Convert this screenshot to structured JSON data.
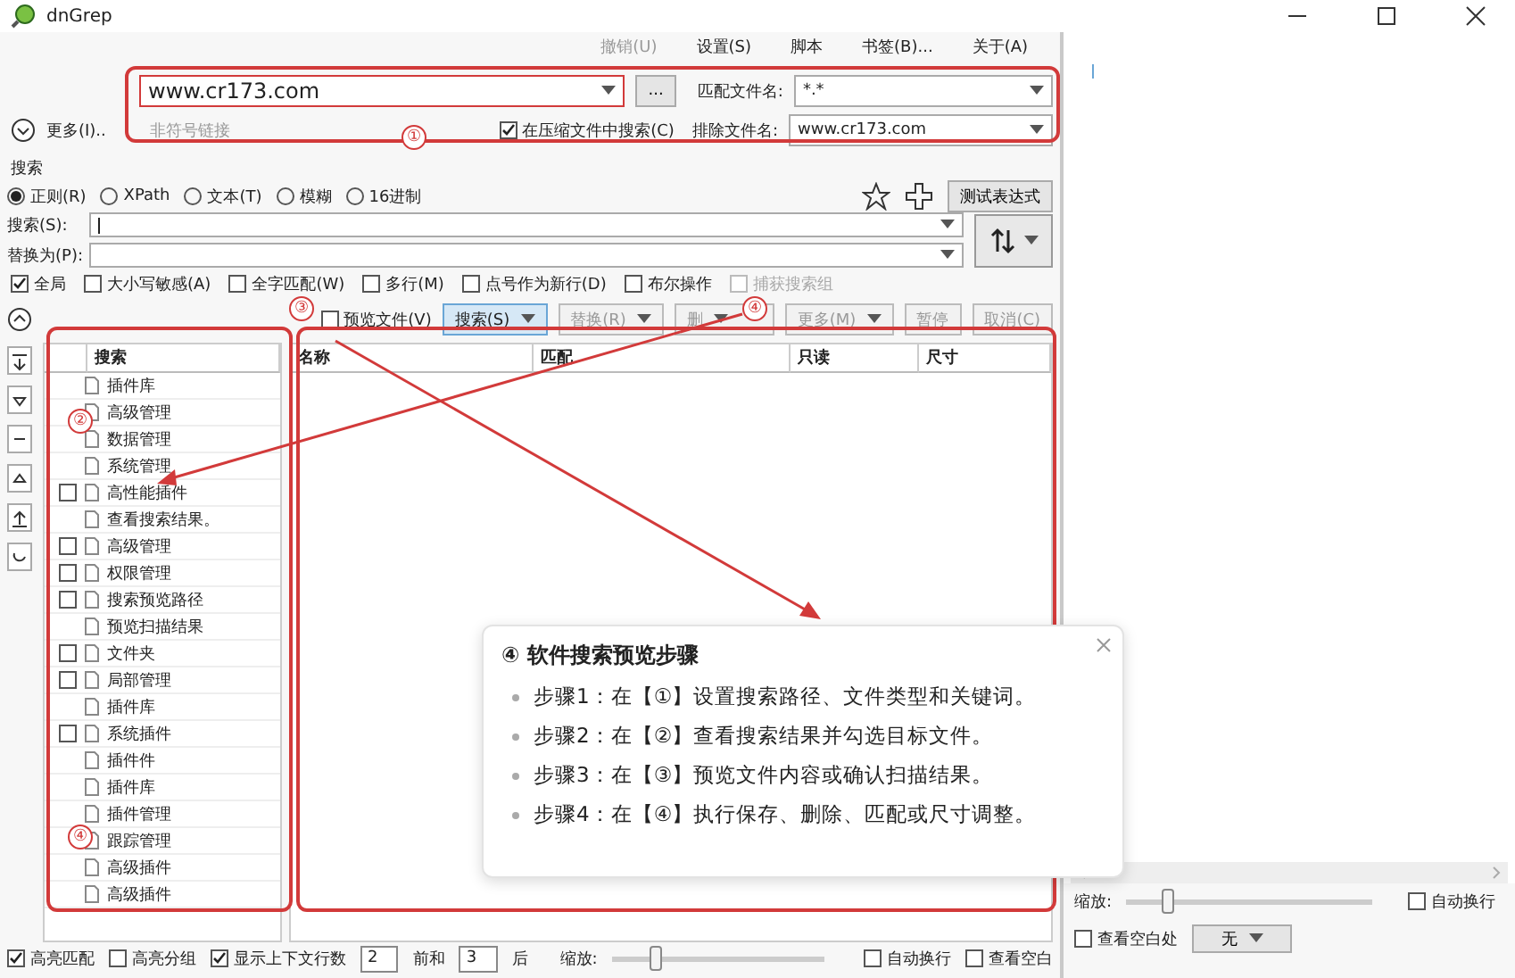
{
  "window": {
    "title": "dnGrep"
  },
  "menu": [
    {
      "label": "撤销(U)",
      "disabled": true
    },
    {
      "label": "设置(S)",
      "disabled": false
    },
    {
      "label": "脚本",
      "disabled": false
    },
    {
      "label": "书签(B)...",
      "disabled": false
    },
    {
      "label": "关于(A)",
      "disabled": false
    }
  ],
  "path": {
    "value": "www.cr173.com",
    "browse": "...",
    "expand_label": "更多(I)..",
    "hint": "非符号链接",
    "archive": {
      "label": "在压缩文件中搜索(C)",
      "checked": true
    },
    "include": {
      "label": "匹配文件名:",
      "value": "*.*"
    },
    "exclude": {
      "label": "排除文件名:",
      "value": "www.cr173.com"
    }
  },
  "search": {
    "title": "搜索",
    "modes": [
      {
        "label": "正则(R)",
        "selected": true
      },
      {
        "label": "XPath",
        "selected": false
      },
      {
        "label": "文本(T)",
        "selected": false
      },
      {
        "label": "模糊",
        "selected": false
      },
      {
        "label": "16进制",
        "selected": false
      }
    ],
    "test_button": "测试表达式",
    "search_label": "搜索(S):",
    "replace_label": "替换为(P):",
    "options": [
      {
        "label": "全局",
        "checked": true,
        "disabled": false
      },
      {
        "label": "大小写敏感(A)",
        "checked": false,
        "disabled": false
      },
      {
        "label": "全字匹配(W)",
        "checked": false,
        "disabled": false
      },
      {
        "label": "多行(M)",
        "checked": false,
        "disabled": false
      },
      {
        "label": "点号作为新行(D)",
        "checked": false,
        "disabled": false
      },
      {
        "label": "布尔操作",
        "checked": false,
        "disabled": false
      },
      {
        "label": "捕获搜索组",
        "checked": false,
        "disabled": true
      }
    ]
  },
  "actions": {
    "preview": {
      "label": "预览文件(V)",
      "checked": false
    },
    "buttons": [
      {
        "label": "搜索(S)",
        "primary": true,
        "disabled": false,
        "dropdown": true
      },
      {
        "label": "替换(R)",
        "primary": false,
        "disabled": true,
        "dropdown": true
      },
      {
        "label": "删",
        "primary": false,
        "disabled": true,
        "dropdown": true
      },
      {
        "label": "更多(M)",
        "primary": false,
        "disabled": true,
        "dropdown": true
      },
      {
        "label": "暂停",
        "primary": false,
        "disabled": true,
        "dropdown": false
      },
      {
        "label": "取消(C)",
        "primary": false,
        "disabled": true,
        "dropdown": false
      }
    ]
  },
  "tree": {
    "header": "搜索",
    "items": [
      {
        "label": "插件库",
        "kind": "plain"
      },
      {
        "label": "高级管理",
        "kind": "plain"
      },
      {
        "label": "数据管理",
        "kind": "plain"
      },
      {
        "label": "系统管理",
        "kind": "plain"
      },
      {
        "label": "高性能插件",
        "kind": "check",
        "checked": false
      },
      {
        "label": "查看搜索结果。",
        "kind": "plain"
      },
      {
        "label": "高级管理",
        "kind": "check",
        "checked": false
      },
      {
        "label": "权限管理",
        "kind": "check",
        "checked": false
      },
      {
        "label": "搜索预览路径",
        "kind": "check",
        "checked": false
      },
      {
        "label": "预览扫描结果",
        "kind": "plain"
      },
      {
        "label": "文件夹",
        "kind": "check",
        "checked": false
      },
      {
        "label": "局部管理",
        "kind": "check",
        "checked": false
      },
      {
        "label": "插件库",
        "kind": "plain"
      },
      {
        "label": "系统插件",
        "kind": "check",
        "checked": false
      },
      {
        "label": "插件件",
        "kind": "plain"
      },
      {
        "label": "插件库",
        "kind": "plain"
      },
      {
        "label": "插件管理",
        "kind": "plain"
      },
      {
        "label": "跟踪管理",
        "kind": "plain"
      },
      {
        "label": "高级插件",
        "kind": "plain"
      },
      {
        "label": "高级插件",
        "kind": "plain"
      }
    ]
  },
  "results": {
    "columns": [
      "名称",
      "匹配",
      "只读",
      "尺寸"
    ]
  },
  "bottom": {
    "highlight": {
      "label": "高亮匹配",
      "checked": true
    },
    "group": {
      "label": "高亮分组",
      "checked": false
    },
    "context": {
      "label": "显示上下文行数",
      "checked": true
    },
    "before": "2",
    "between": "前和",
    "after": "3",
    "after_label": "后",
    "zoom_label": "缩放:",
    "zoom": {
      "level": 0.18
    },
    "wrap": {
      "label": "自动换行",
      "checked": false
    },
    "whitespace": {
      "label": "查看空白",
      "checked": false
    }
  },
  "preview_pane": {
    "zoom_label": "缩放:",
    "zoom": {
      "level": 0.15
    },
    "wrap": {
      "label": "自动换行",
      "checked": false
    },
    "whitespace": {
      "label": "查看空白处",
      "checked": false
    },
    "highlighter": "无"
  },
  "annotations": {
    "markers": [
      "①",
      "②",
      "③",
      "④",
      "④"
    ],
    "popup": {
      "title": "④ 软件搜索预览步骤",
      "steps": [
        "步骤1：在【①】设置搜索路径、文件类型和关键词。",
        "步骤2：在【②】查看搜索结果并勾选目标文件。",
        "步骤3：在【③】预览文件内容或确认扫描结果。",
        "步骤4：在【④】执行保存、删除、匹配或尺寸调整。"
      ]
    }
  }
}
